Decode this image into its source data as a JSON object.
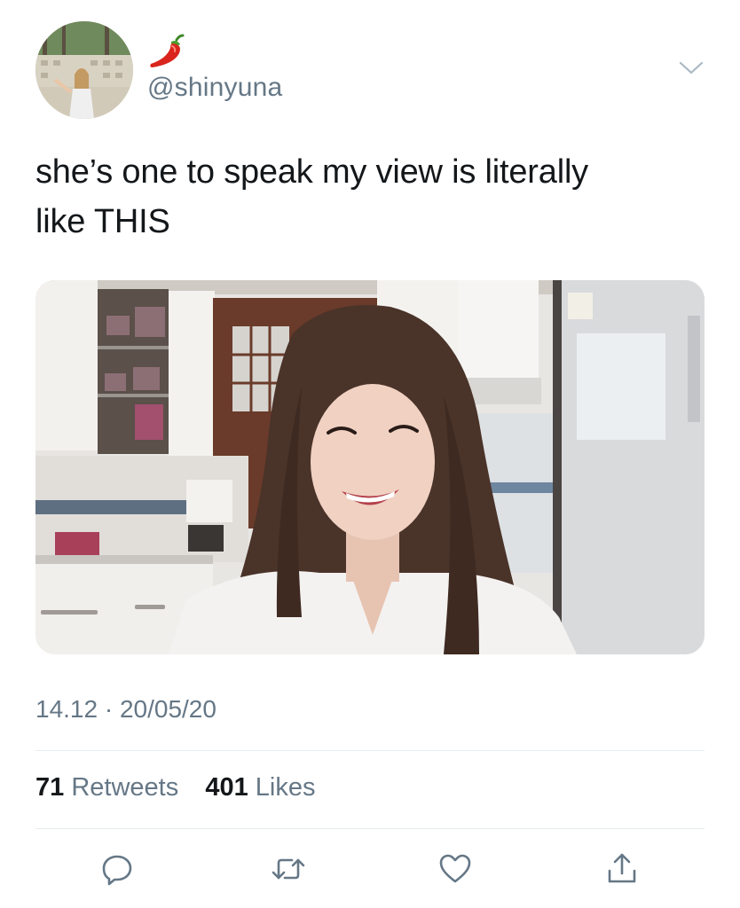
{
  "user": {
    "handle": "@shinyuna",
    "display_name_icon": "hot-pepper-emoji",
    "avatar_icon": "profile-photo"
  },
  "tweet": {
    "text_line1": "she’s one to speak my view is literally",
    "text_line2": "like THIS",
    "media_icon": "photo-attachment",
    "timestamp": "14.12 · 20/05/20"
  },
  "stats": {
    "retweets_count": "71",
    "retweets_label": "Retweets",
    "likes_count": "401",
    "likes_label": "Likes"
  },
  "actions": [
    "reply-icon",
    "retweet-icon",
    "like-icon",
    "share-icon"
  ],
  "colors": {
    "text_primary": "#14171a",
    "text_secondary": "#657786",
    "divider": "#e6ecf0",
    "icon": "#657786",
    "pepper": "#d9251d"
  }
}
